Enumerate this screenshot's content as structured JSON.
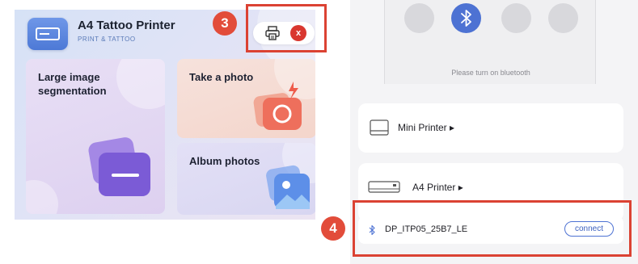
{
  "left_app": {
    "title": "A4 Tattoo Printer",
    "subtitle": "PRINT & TATTOO",
    "close_label": "x",
    "tiles": {
      "large_image": "Large image segmentation",
      "take_photo": "Take a photo",
      "album_photos": "Album photos"
    }
  },
  "right_app": {
    "bluetooth_hint": "Please turn on bluetooth",
    "printer_types": [
      {
        "label": "Mini Printer ▸"
      },
      {
        "label": "A4 Printer ▸"
      }
    ],
    "device": {
      "name": "DP_ITP05_25B7_LE",
      "connect_label": "connect"
    }
  },
  "annotations": [
    {
      "number": "3"
    },
    {
      "number": "4"
    }
  ],
  "colors": {
    "annotation": "#db4233",
    "accent_blue": "#4d72d3",
    "close_red": "#d9372f"
  },
  "icons": [
    "app-card-icon",
    "printer-icon",
    "close-icon",
    "bluetooth-icon",
    "camera-icon",
    "gallery-icon",
    "mini-printer-icon",
    "a4-printer-icon"
  ]
}
